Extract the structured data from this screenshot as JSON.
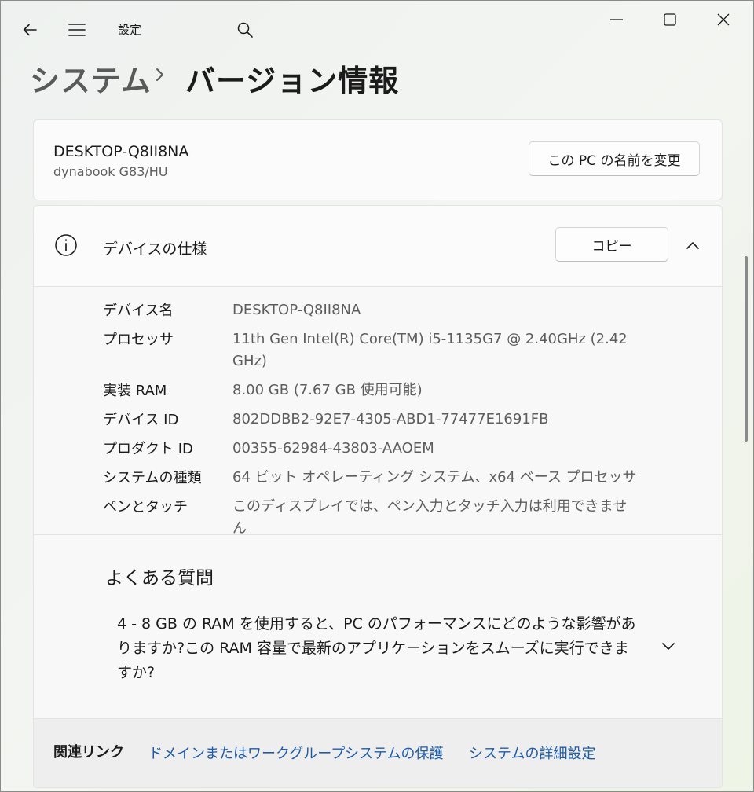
{
  "titlebar": {
    "app_title": "設定",
    "icons": [
      "back-arrow-icon",
      "hamburger-menu-icon",
      "search-icon",
      "minimize-icon",
      "maximize-icon",
      "close-icon"
    ]
  },
  "breadcrumb": {
    "parent": "システム",
    "separator_icon": "chevron-right-icon",
    "current": "バージョン情報"
  },
  "pc_card": {
    "name": "DESKTOP-Q8II8NA",
    "model": "dynabook G83/HU",
    "rename_button": "この PC の名前を変更"
  },
  "device_specs": {
    "title": "デバイスの仕様",
    "icon": "info-icon",
    "copy_button": "コピー",
    "expanded": true,
    "rows": [
      {
        "label": "デバイス名",
        "value": "DESKTOP-Q8II8NA"
      },
      {
        "label": "プロセッサ",
        "value": "11th Gen Intel(R) Core(TM) i5-1135G7 @ 2.40GHz (2.42 GHz)"
      },
      {
        "label": "実装 RAM",
        "value": "8.00 GB (7.67 GB 使用可能)"
      },
      {
        "label": "デバイス ID",
        "value": "802DDBB2-92E7-4305-ABD1-77477E1691FB"
      },
      {
        "label": "プロダクト ID",
        "value": "00355-62984-43803-AAOEM"
      },
      {
        "label": "システムの種類",
        "value": "64 ビット オペレーティング システム、x64 ベース プロセッサ"
      },
      {
        "label": "ペンとタッチ",
        "value": "このディスプレイでは、ペン入力とタッチ入力は利用できません"
      }
    ]
  },
  "faq": {
    "title": "よくある質問",
    "question": "4 - 8 GB の RAM を使用すると、PC のパフォーマンスにどのような影響がありますか?この RAM 容量で最新のアプリケーションをスムーズに実行できますか?"
  },
  "related": {
    "label": "関連リンク",
    "links": [
      "ドメインまたはワークグループ",
      "システムの保護",
      "システムの詳細設定"
    ]
  },
  "colors": {
    "link": "#1e5ca8",
    "secondary_text": "#5d5d5d",
    "card_bg": "#fbfbfb"
  }
}
